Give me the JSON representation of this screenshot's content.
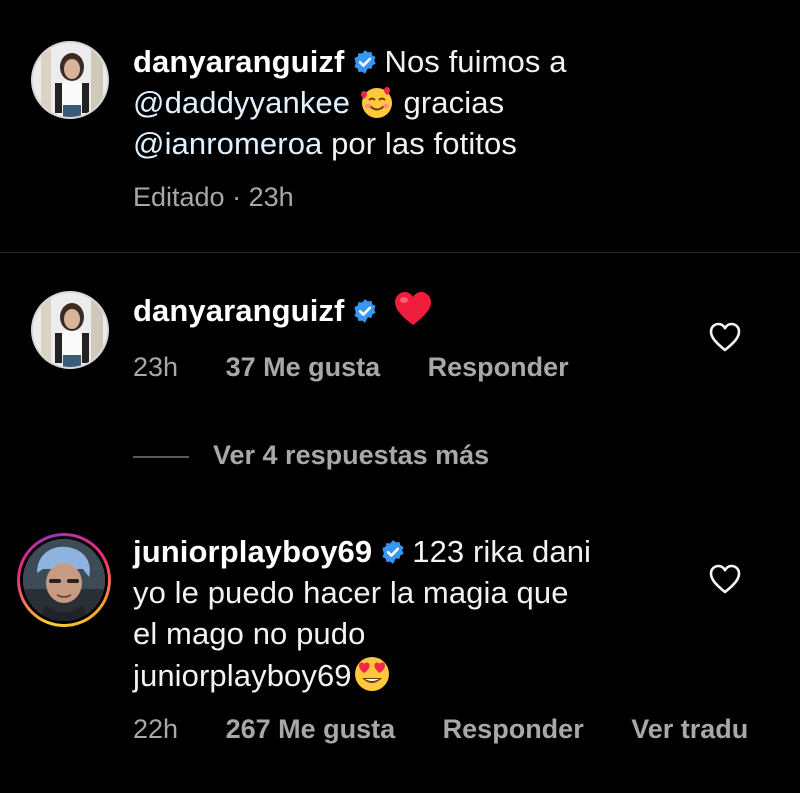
{
  "caption": {
    "username": "danyaranguizf",
    "text_before": "Nos fuimos a",
    "mention_1": "@daddyyankee",
    "emoji_1": "smiling-face-with-hearts",
    "text_middle": "gracias",
    "mention_2": "@ianromeroa",
    "text_after": "por las fotitos",
    "meta": "Editado · 23h"
  },
  "comments": [
    {
      "username": "danyaranguizf",
      "emoji": "red-heart",
      "time": "23h",
      "likes": "37 Me gusta",
      "reply_label": "Responder"
    },
    {
      "username": "juniorplayboy69",
      "line1": "123 rika dani",
      "line2": "yo le puedo hacer la magia que",
      "line3": "el mago no pudo",
      "line4": "juniorplayboy69",
      "emoji": "heart-eyes",
      "time": "22h",
      "likes": "267 Me gusta",
      "reply_label": "Responder",
      "translate_label": "Ver tradu"
    }
  ],
  "view_replies": "Ver 4 respuestas más",
  "colors": {
    "background": "#000000",
    "text": "#f5f5f5",
    "mention": "#e0f1ff",
    "meta": "#a8a8a8",
    "verified": "#3897f0"
  }
}
